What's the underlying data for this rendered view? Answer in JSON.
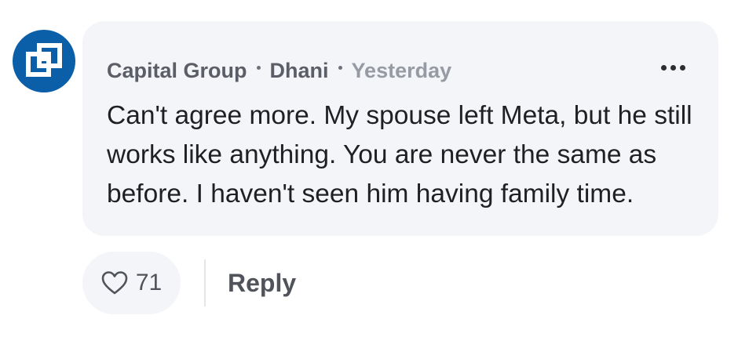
{
  "comment": {
    "author": {
      "organization": "Capital Group",
      "name": "Dhani",
      "avatar_icon": "capital-group-logo-icon",
      "avatar_color": "#0b5ea8"
    },
    "timestamp": "Yesterday",
    "text": "Can't agree more. My spouse left Meta, but he still works like anything. You are never the same as before. I haven't seen him having family time.",
    "more_icon": "more-options-icon"
  },
  "actions": {
    "like_icon": "heart-icon",
    "like_count": "71",
    "reply_label": "Reply"
  }
}
